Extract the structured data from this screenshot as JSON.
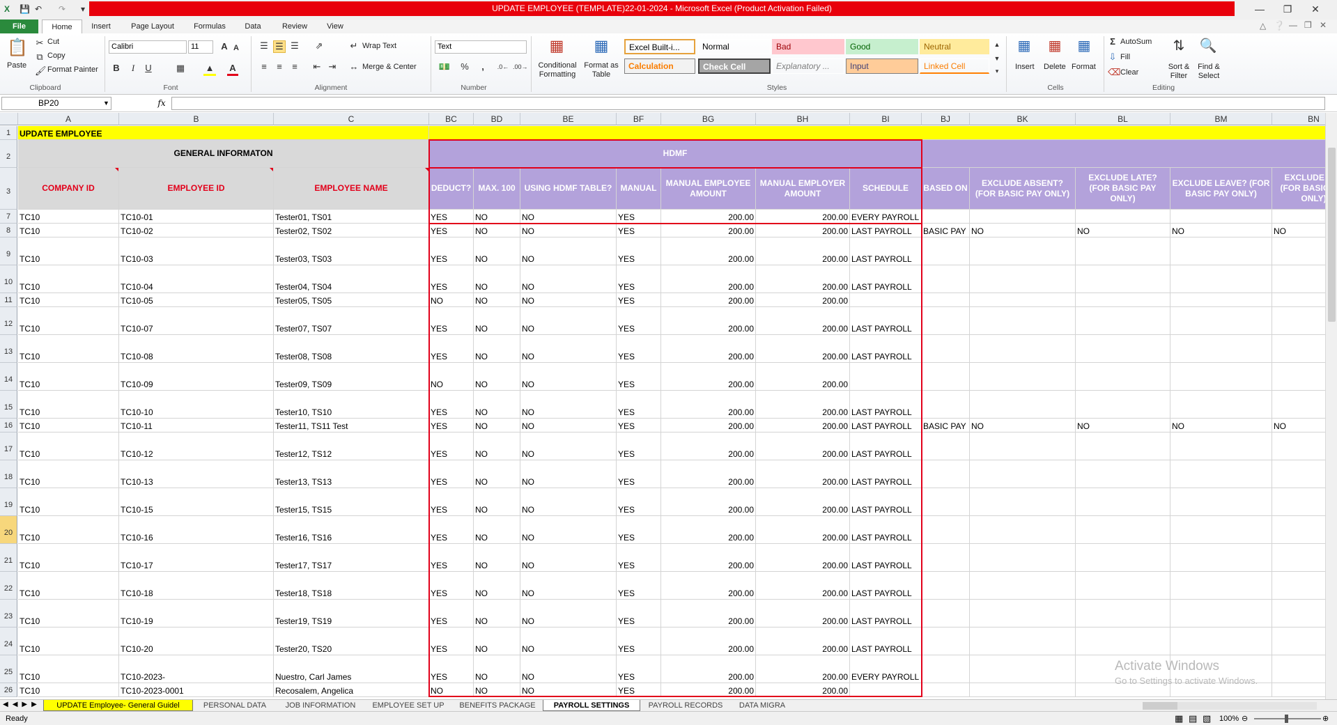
{
  "window": {
    "title": "UPDATE EMPLOYEE (TEMPLATE)22-01-2024  -  Microsoft Excel (Product Activation Failed)"
  },
  "ribbon": {
    "tabs": [
      "File",
      "Home",
      "Insert",
      "Page Layout",
      "Formulas",
      "Data",
      "Review",
      "View"
    ],
    "active_tab": "Home",
    "clipboard": {
      "paste": "Paste",
      "cut": "Cut",
      "copy": "Copy",
      "format_painter": "Format Painter",
      "label": "Clipboard"
    },
    "font": {
      "name": "Calibri",
      "size": "11",
      "label": "Font",
      "bold": "B",
      "italic": "I",
      "underline": "U"
    },
    "alignment": {
      "wrap_text": "Wrap Text",
      "merge_center": "Merge & Center",
      "label": "Alignment"
    },
    "number": {
      "format": "Text",
      "label": "Number",
      "percent": "%",
      "comma": ","
    },
    "styles": {
      "conditional": "Conditional Formatting",
      "format_table": "Format as Table",
      "label": "Styles",
      "items": [
        {
          "label": "Excel Built-i...",
          "bg": "#ffffff",
          "fg": "#000000",
          "border": "#e6a23c"
        },
        {
          "label": "Normal",
          "bg": "#ffffff",
          "fg": "#000000",
          "border": "#ffffff"
        },
        {
          "label": "Bad",
          "bg": "#ffc7ce",
          "fg": "#9c0006",
          "border": "#ffc7ce"
        },
        {
          "label": "Good",
          "bg": "#c6efce",
          "fg": "#006100",
          "border": "#c6efce"
        },
        {
          "label": "Neutral",
          "bg": "#ffeb9c",
          "fg": "#9c6500",
          "border": "#ffeb9c"
        },
        {
          "label": "Calculation",
          "bg": "#f2f2f2",
          "fg": "#fa7d00",
          "border": "#7f7f7f"
        },
        {
          "label": "Check Cell",
          "bg": "#a5a5a5",
          "fg": "#ffffff",
          "border": "#3f3f3f"
        },
        {
          "label": "Explanatory ...",
          "bg": "#ffffff",
          "fg": "#7f7f7f",
          "border": "#ffffff"
        },
        {
          "label": "Input",
          "bg": "#ffcc99",
          "fg": "#3f3f76",
          "border": "#7f7f7f"
        },
        {
          "label": "Linked Cell",
          "bg": "#ffffff",
          "fg": "#fa7d00",
          "border": "#ff8001"
        }
      ]
    },
    "cells": {
      "insert": "Insert",
      "delete": "Delete",
      "format": "Format",
      "label": "Cells"
    },
    "editing": {
      "autosum": "AutoSum",
      "fill": "Fill",
      "clear": "Clear",
      "sort_filter": "Sort & Filter",
      "find_select": "Find & Select",
      "label": "Editing"
    }
  },
  "formula_bar": {
    "name_box": "BP20",
    "fx": "fx",
    "formula": ""
  },
  "columns": [
    "A",
    "B",
    "C",
    "BC",
    "BD",
    "BE",
    "BF",
    "BG",
    "BH",
    "BI",
    "BJ",
    "BK",
    "BL",
    "BM",
    "BN"
  ],
  "row_numbers": [
    "1",
    "2",
    "3",
    "7",
    "8",
    "9",
    "10",
    "11",
    "12",
    "13",
    "14",
    "15",
    "16",
    "17",
    "18",
    "19",
    "20",
    "21",
    "22",
    "23",
    "24",
    "25",
    "26"
  ],
  "selected_row": "20",
  "sheet": {
    "title": "UPDATE EMPLOYEE",
    "general_header": "GENERAL INFORMATON",
    "hdmf_header": "HDMF",
    "headers": {
      "company_id": "COMPANY ID",
      "employee_id": "EMPLOYEE ID",
      "employee_name": "EMPLOYEE NAME",
      "deduct": "DEDUCT?",
      "max100": "MAX. 100",
      "using_hdmf_table": "USING HDMF TABLE?",
      "manual": "MANUAL",
      "manual_employee_amount": "MANUAL EMPLOYEE AMOUNT",
      "manual_employer_amount": "MANUAL EMPLOYER AMOUNT",
      "schedule": "SCHEDULE",
      "based_on": "BASED ON",
      "exclude_absent": "EXCLUDE ABSENT? (FOR BASIC PAY ONLY)",
      "exclude_late": "EXCLUDE LATE? (FOR BASIC PAY ONLY)",
      "exclude_leave": "EXCLUDE LEAVE? (FOR BASIC PAY ONLY)",
      "exclude_ut": "EXCLUDE UT? (FOR BASIC PAY ONLY)"
    },
    "rows": [
      {
        "n": "7",
        "company": "TC10",
        "emp_id": "TC10-01",
        "name": "Tester01, TS01",
        "deduct": "YES",
        "max100": "NO",
        "table": "NO",
        "manual": "YES",
        "ee": "200.00",
        "er": "200.00",
        "schedule": "EVERY PAYROLL",
        "based_on": "",
        "absent": "",
        "late": "",
        "leave": "",
        "ut": ""
      },
      {
        "n": "8",
        "company": "TC10",
        "emp_id": "TC10-02",
        "name": "Tester02, TS02",
        "deduct": "YES",
        "max100": "NO",
        "table": "NO",
        "manual": "YES",
        "ee": "200.00",
        "er": "200.00",
        "schedule": "LAST PAYROLL",
        "based_on": "BASIC PAY",
        "absent": "NO",
        "late": "NO",
        "leave": "NO",
        "ut": "NO"
      },
      {
        "n": "9",
        "company": "TC10",
        "emp_id": "TC10-03",
        "name": "Tester03, TS03",
        "deduct": "YES",
        "max100": "NO",
        "table": "NO",
        "manual": "YES",
        "ee": "200.00",
        "er": "200.00",
        "schedule": "LAST PAYROLL",
        "based_on": "",
        "absent": "",
        "late": "",
        "leave": "",
        "ut": ""
      },
      {
        "n": "10",
        "company": "TC10",
        "emp_id": "TC10-04",
        "name": "Tester04, TS04",
        "deduct": "YES",
        "max100": "NO",
        "table": "NO",
        "manual": "YES",
        "ee": "200.00",
        "er": "200.00",
        "schedule": "LAST PAYROLL",
        "based_on": "",
        "absent": "",
        "late": "",
        "leave": "",
        "ut": ""
      },
      {
        "n": "11",
        "company": "TC10",
        "emp_id": "TC10-05",
        "name": "Tester05, TS05",
        "deduct": "NO",
        "max100": "NO",
        "table": "NO",
        "manual": "YES",
        "ee": "200.00",
        "er": "200.00",
        "schedule": "",
        "based_on": "",
        "absent": "",
        "late": "",
        "leave": "",
        "ut": ""
      },
      {
        "n": "12",
        "company": "TC10",
        "emp_id": "TC10-07",
        "name": "Tester07, TS07",
        "deduct": "YES",
        "max100": "NO",
        "table": "NO",
        "manual": "YES",
        "ee": "200.00",
        "er": "200.00",
        "schedule": "LAST PAYROLL",
        "based_on": "",
        "absent": "",
        "late": "",
        "leave": "",
        "ut": ""
      },
      {
        "n": "13",
        "company": "TC10",
        "emp_id": "TC10-08",
        "name": "Tester08, TS08",
        "deduct": "YES",
        "max100": "NO",
        "table": "NO",
        "manual": "YES",
        "ee": "200.00",
        "er": "200.00",
        "schedule": "LAST PAYROLL",
        "based_on": "",
        "absent": "",
        "late": "",
        "leave": "",
        "ut": ""
      },
      {
        "n": "14",
        "company": "TC10",
        "emp_id": "TC10-09",
        "name": "Tester09, TS09",
        "deduct": "NO",
        "max100": "NO",
        "table": "NO",
        "manual": "YES",
        "ee": "200.00",
        "er": "200.00",
        "schedule": "",
        "based_on": "",
        "absent": "",
        "late": "",
        "leave": "",
        "ut": ""
      },
      {
        "n": "15",
        "company": "TC10",
        "emp_id": "TC10-10",
        "name": "Tester10, TS10",
        "deduct": "YES",
        "max100": "NO",
        "table": "NO",
        "manual": "YES",
        "ee": "200.00",
        "er": "200.00",
        "schedule": "LAST PAYROLL",
        "based_on": "",
        "absent": "",
        "late": "",
        "leave": "",
        "ut": ""
      },
      {
        "n": "16",
        "company": "TC10",
        "emp_id": "TC10-11",
        "name": "Tester11, TS11 Test",
        "deduct": "YES",
        "max100": "NO",
        "table": "NO",
        "manual": "YES",
        "ee": "200.00",
        "er": "200.00",
        "schedule": "LAST PAYROLL",
        "based_on": "BASIC PAY",
        "absent": "NO",
        "late": "NO",
        "leave": "NO",
        "ut": "NO"
      },
      {
        "n": "17",
        "company": "TC10",
        "emp_id": "TC10-12",
        "name": "Tester12, TS12",
        "deduct": "YES",
        "max100": "NO",
        "table": "NO",
        "manual": "YES",
        "ee": "200.00",
        "er": "200.00",
        "schedule": "LAST PAYROLL",
        "based_on": "",
        "absent": "",
        "late": "",
        "leave": "",
        "ut": ""
      },
      {
        "n": "18",
        "company": "TC10",
        "emp_id": "TC10-13",
        "name": "Tester13, TS13",
        "deduct": "YES",
        "max100": "NO",
        "table": "NO",
        "manual": "YES",
        "ee": "200.00",
        "er": "200.00",
        "schedule": "LAST PAYROLL",
        "based_on": "",
        "absent": "",
        "late": "",
        "leave": "",
        "ut": ""
      },
      {
        "n": "19",
        "company": "TC10",
        "emp_id": "TC10-15",
        "name": "Tester15, TS15",
        "deduct": "YES",
        "max100": "NO",
        "table": "NO",
        "manual": "YES",
        "ee": "200.00",
        "er": "200.00",
        "schedule": "LAST PAYROLL",
        "based_on": "",
        "absent": "",
        "late": "",
        "leave": "",
        "ut": ""
      },
      {
        "n": "20",
        "company": "TC10",
        "emp_id": "TC10-16",
        "name": "Tester16, TS16",
        "deduct": "YES",
        "max100": "NO",
        "table": "NO",
        "manual": "YES",
        "ee": "200.00",
        "er": "200.00",
        "schedule": "LAST PAYROLL",
        "based_on": "",
        "absent": "",
        "late": "",
        "leave": "",
        "ut": ""
      },
      {
        "n": "21",
        "company": "TC10",
        "emp_id": "TC10-17",
        "name": "Tester17, TS17",
        "deduct": "YES",
        "max100": "NO",
        "table": "NO",
        "manual": "YES",
        "ee": "200.00",
        "er": "200.00",
        "schedule": "LAST PAYROLL",
        "based_on": "",
        "absent": "",
        "late": "",
        "leave": "",
        "ut": ""
      },
      {
        "n": "22",
        "company": "TC10",
        "emp_id": "TC10-18",
        "name": "Tester18, TS18",
        "deduct": "YES",
        "max100": "NO",
        "table": "NO",
        "manual": "YES",
        "ee": "200.00",
        "er": "200.00",
        "schedule": "LAST PAYROLL",
        "based_on": "",
        "absent": "",
        "late": "",
        "leave": "",
        "ut": ""
      },
      {
        "n": "23",
        "company": "TC10",
        "emp_id": "TC10-19",
        "name": "Tester19, TS19",
        "deduct": "YES",
        "max100": "NO",
        "table": "NO",
        "manual": "YES",
        "ee": "200.00",
        "er": "200.00",
        "schedule": "LAST PAYROLL",
        "based_on": "",
        "absent": "",
        "late": "",
        "leave": "",
        "ut": ""
      },
      {
        "n": "24",
        "company": "TC10",
        "emp_id": "TC10-20",
        "name": "Tester20, TS20",
        "deduct": "YES",
        "max100": "NO",
        "table": "NO",
        "manual": "YES",
        "ee": "200.00",
        "er": "200.00",
        "schedule": "LAST PAYROLL",
        "based_on": "",
        "absent": "",
        "late": "",
        "leave": "",
        "ut": ""
      },
      {
        "n": "25",
        "company": "TC10",
        "emp_id": "TC10-2023-",
        "name": "Nuestro, Carl James",
        "deduct": "YES",
        "max100": "NO",
        "table": "NO",
        "manual": "YES",
        "ee": "200.00",
        "er": "200.00",
        "schedule": "EVERY PAYROLL",
        "based_on": "",
        "absent": "",
        "late": "",
        "leave": "",
        "ut": ""
      },
      {
        "n": "26",
        "company": "TC10",
        "emp_id": "TC10-2023-0001",
        "name": "Recosalem, Angelica",
        "deduct": "NO",
        "max100": "NO",
        "table": "NO",
        "manual": "YES",
        "ee": "200.00",
        "er": "200.00",
        "schedule": "",
        "based_on": "",
        "absent": "",
        "late": "",
        "leave": "",
        "ut": ""
      }
    ]
  },
  "sheet_tabs": [
    "UPDATE Employee- General Guidel",
    "PERSONAL DATA",
    "JOB INFORMATION",
    "EMPLOYEE SET UP",
    "BENEFITS PACKAGE",
    "PAYROLL SETTINGS",
    "PAYROLL RECORDS",
    "DATA MIGRA"
  ],
  "active_sheet_tab": "PAYROLL SETTINGS",
  "status": {
    "ready": "Ready",
    "zoom": "100%"
  },
  "watermark": {
    "line1": "Activate Windows",
    "line2": "Go to Settings to activate Windows."
  },
  "colors": {
    "accent_red": "#e2001a",
    "title_bar_red": "#e8000b",
    "header_purple": "#b3a2db",
    "title_yellow": "#ffff00",
    "general_gray": "#d9d9d9"
  }
}
